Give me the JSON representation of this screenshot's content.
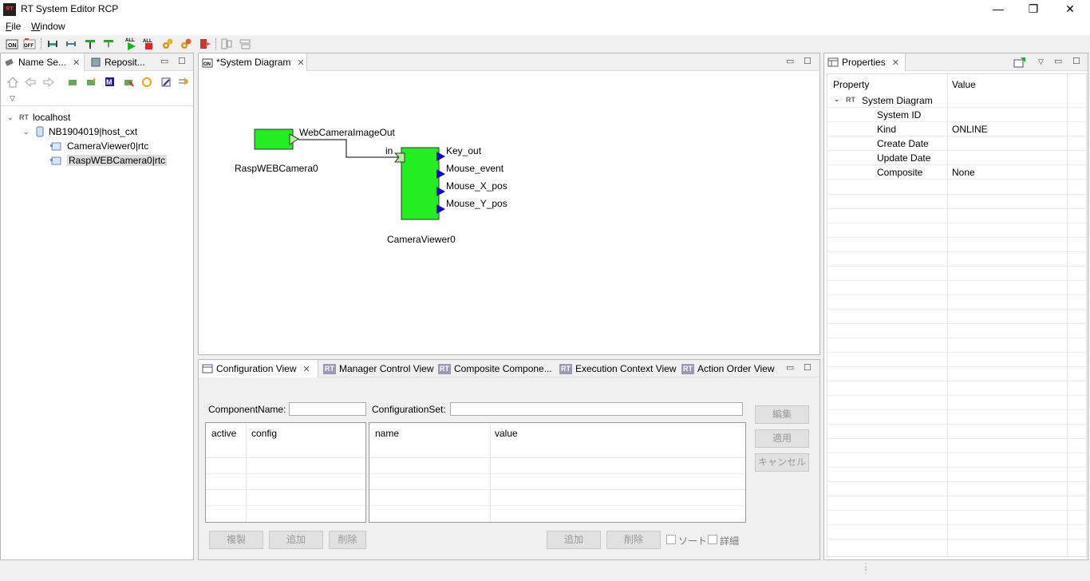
{
  "window": {
    "title": "RT System Editor RCP",
    "app_icon_text": "RT",
    "minimize": "—",
    "maximize": "❐",
    "close": "✕"
  },
  "menu": {
    "file": "File",
    "file_mnemonic": "F",
    "file_rest": "ile",
    "window": "Window",
    "window_mnemonic": "W",
    "window_rest": "indow"
  },
  "toolbar": {
    "all_label": "ALL",
    "on_label": "ON",
    "off_label": "OFF",
    "highlight_color": "#e01010"
  },
  "name_service": {
    "tab_label": "Name Se...",
    "tab2_label": "Reposit...",
    "tree": [
      {
        "label": "localhost",
        "icon": "rt-icon",
        "level": 0
      },
      {
        "label": "NB1904019|host_cxt",
        "icon": "database-icon",
        "level": 1
      },
      {
        "label": "CameraViewer0|rtc",
        "icon": "component-icon",
        "level": 2
      },
      {
        "label": "RaspWEBCamera0|rtc",
        "icon": "component-icon",
        "level": 2,
        "selected": true
      }
    ]
  },
  "diagram": {
    "tab_label": "*System Diagram",
    "component1": {
      "name": "RaspWEBCamera0",
      "port": "WebCameraImageOut",
      "color": "#22ee22"
    },
    "component2": {
      "name": "CameraViewer0",
      "in_port": "in",
      "out_ports": [
        "Key_out",
        "Mouse_event",
        "Mouse_X_pos",
        "Mouse_Y_pos"
      ],
      "color": "#22ee22",
      "port_color": "#0000dd"
    }
  },
  "properties": {
    "tab_label": "Properties",
    "col_property": "Property",
    "col_value": "Value",
    "root_label": "System Diagram",
    "rows": [
      {
        "property": "System ID",
        "value": ""
      },
      {
        "property": "Kind",
        "value": "ONLINE"
      },
      {
        "property": "Create Date",
        "value": ""
      },
      {
        "property": "Update Date",
        "value": ""
      },
      {
        "property": "Composite",
        "value": "None"
      }
    ]
  },
  "bottom_tabs": {
    "config": "Configuration View",
    "manager": "Manager Control View",
    "composite": "Composite Compone...",
    "exec_context": "Execution Context View",
    "action_order": "Action Order View"
  },
  "config_view": {
    "component_name_label": "ComponentName:",
    "component_name_value": "",
    "config_set_label": "ConfigurationSet:",
    "config_set_value": "",
    "left_cols": [
      "active",
      "config"
    ],
    "right_cols": [
      "name",
      "value"
    ],
    "edit_btn": "編集",
    "apply_btn": "適用",
    "cancel_btn": "キャンセル",
    "copy_btn": "複製",
    "add_btn": "追加",
    "delete_btn": "削除",
    "add_btn2": "追加",
    "delete_btn2": "削除",
    "sort_label": "ソート",
    "detail_label": "詳細"
  }
}
